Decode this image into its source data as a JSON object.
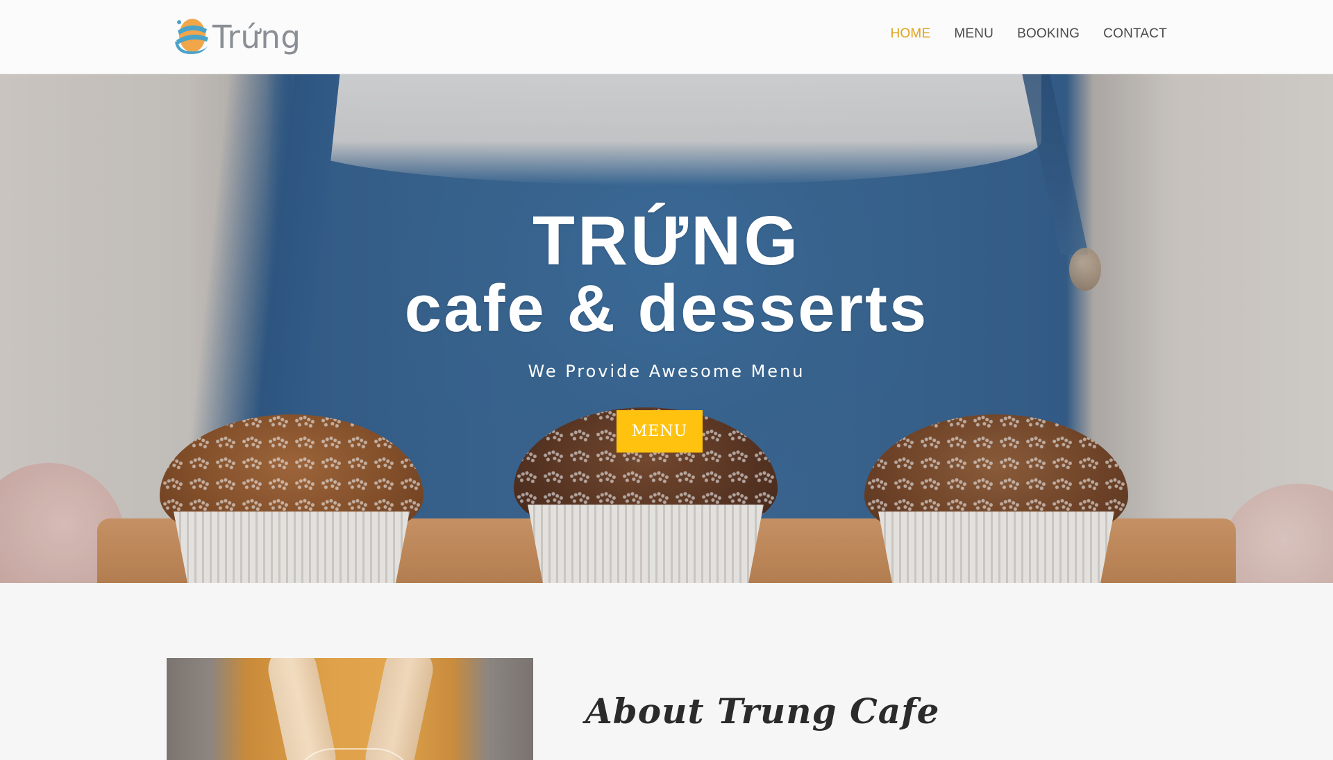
{
  "brand": {
    "logo_text": "Trứng",
    "logo_icon": "egg-logo-icon",
    "accent_color": "#ffc20e",
    "nav_active_color": "#e0a21a"
  },
  "nav": {
    "items": [
      {
        "label": "HOME",
        "active": true
      },
      {
        "label": "MENU",
        "active": false
      },
      {
        "label": "BOOKING",
        "active": false
      },
      {
        "label": "CONTACT",
        "active": false
      }
    ]
  },
  "hero": {
    "title": "TRỨNG",
    "subtitle": "cafe & desserts",
    "tagline": "We Provide Awesome Menu",
    "button_label": "MENU"
  },
  "about": {
    "title": "About Trung Cafe"
  }
}
